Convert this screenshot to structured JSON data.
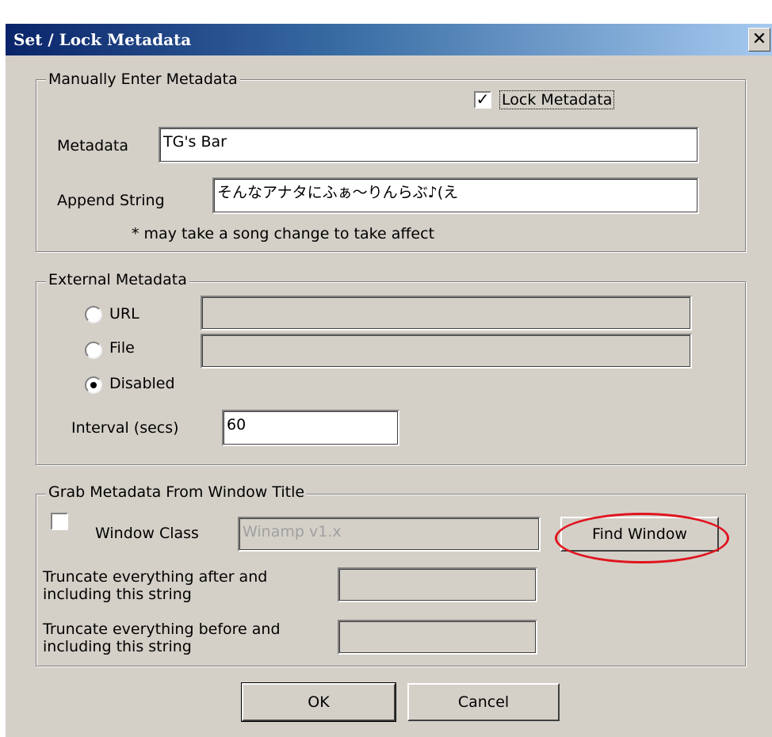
{
  "window": {
    "title": "Set / Lock Metadata",
    "close_glyph": "✕"
  },
  "manual": {
    "legend": "Manually Enter Metadata",
    "lock_checkbox_checked": true,
    "lock_label": "Lock Metadata",
    "metadata_label": "Metadata",
    "metadata_value": "TG's Bar",
    "append_label": "Append String",
    "append_value": "そんなアナタにふぁ〜りんらぶ♪(え",
    "note": "* may take a song change to take affect"
  },
  "external": {
    "legend": "External Metadata",
    "options": [
      {
        "label": "URL",
        "checked": false,
        "value": ""
      },
      {
        "label": "File",
        "checked": false,
        "value": ""
      },
      {
        "label": "Disabled",
        "checked": true
      }
    ],
    "interval_label": "Interval (secs)",
    "interval_value": "60"
  },
  "grab": {
    "legend": "Grab Metadata From Window Title",
    "checkbox_checked": false,
    "window_class_label": "Window Class",
    "window_class_value": "Winamp v1.x",
    "find_window_label": "Find Window",
    "truncate_after_label_1": "Truncate everything after and",
    "truncate_after_label_2": "including this string",
    "truncate_after_value": "",
    "truncate_before_label_1": "Truncate everything before and",
    "truncate_before_label_2": "including this string",
    "truncate_before_value": ""
  },
  "buttons": {
    "ok": "OK",
    "cancel": "Cancel"
  },
  "colors": {
    "highlight_ellipse": "#e0141e",
    "title_bar": "#0a246a",
    "face": "#d4d0c8"
  }
}
